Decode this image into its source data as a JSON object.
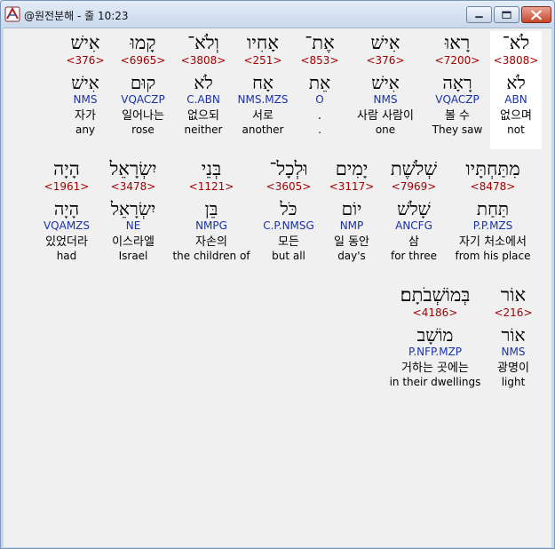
{
  "window": {
    "title": "@원전분해 - 줄 10:23",
    "minimize_label": "minimize",
    "maximize_label": "maximize",
    "close_label": "close"
  },
  "rows": [
    {
      "words": [
        {
          "heb": "לֹא־",
          "num": "<3808>",
          "lemma": "לֹא",
          "parse": "ABN",
          "kor": "없으며",
          "eng": "not",
          "selected": true
        },
        {
          "heb": "רָאוּ",
          "num": "<7200>",
          "lemma": "רָאָה",
          "parse": "VQACZP",
          "kor": "볼 수",
          "eng": "They saw"
        },
        {
          "heb": "אִישׁ",
          "num": "<376>",
          "lemma": "אִישׁ",
          "parse": "NMS",
          "kor": "사람 사람이",
          "eng": "one"
        },
        {
          "heb": "אֶת־",
          "num": "<853>",
          "lemma": "אֵת",
          "parse": "O",
          "kor": ".",
          "eng": "."
        },
        {
          "heb": "אָחִיו",
          "num": "<251>",
          "lemma": "אָח",
          "parse": "NMS.MZS",
          "kor": "서로",
          "eng": "another"
        },
        {
          "heb": "וְלֹא־",
          "num": "<3808>",
          "lemma": "לֹא",
          "parse": "C.ABN",
          "kor": "없으되",
          "eng": "neither"
        },
        {
          "heb": "קָמוּ",
          "num": "<6965>",
          "lemma": "קוּם",
          "parse": "VQACZP",
          "kor": "일어나는",
          "eng": "rose"
        },
        {
          "heb": "אִישׁ",
          "num": "<376>",
          "lemma": "אִישׁ",
          "parse": "NMS",
          "kor": "자가",
          "eng": "any"
        }
      ]
    },
    {
      "words": [
        {
          "heb": "מִתַּחְתָּיו",
          "num": "<8478>",
          "lemma": "תַּחַת",
          "parse": "P.P.MZS",
          "kor": "자기 처소에서",
          "eng": "from his place"
        },
        {
          "heb": "שְׁלֹשֶׁת",
          "num": "<7969>",
          "lemma": "שָׁלֹשׁ",
          "parse": "ANCFG",
          "kor": "삼",
          "eng": "for three"
        },
        {
          "heb": "יָמִים",
          "num": "<3117>",
          "lemma": "יוֹם",
          "parse": "NMP",
          "kor": "일 동안",
          "eng": "day's"
        },
        {
          "heb": "וּלְכָל־",
          "num": "<3605>",
          "lemma": "כֹּל",
          "parse": "C.P.NMSG",
          "kor": "모든",
          "eng": "but all"
        },
        {
          "heb": "בְּנֵי",
          "num": "<1121>",
          "lemma": "בֵּן",
          "parse": "NMPG",
          "kor": "자손의",
          "eng": "the children of"
        },
        {
          "heb": "יִשְׂרָאֵל",
          "num": "<3478>",
          "lemma": "יִשְׂרָאֵל",
          "parse": "NE",
          "kor": "이스라엘",
          "eng": "Israel"
        },
        {
          "heb": "הָיָה",
          "num": "<1961>",
          "lemma": "הָיָה",
          "parse": "VQAMZS",
          "kor": "있었더라",
          "eng": "had"
        }
      ]
    },
    {
      "words": [
        {
          "heb": "אוֹר",
          "num": "<216>",
          "lemma": "אוֹר",
          "parse": "NMS",
          "kor": "광명이",
          "eng": "light"
        },
        {
          "heb": "בְּמוֹשְׁבֹתָם׃",
          "num": "<4186>",
          "lemma": "מוֹשָׁב",
          "parse": "P.NFP.MZP",
          "kor": "거하는 곳에는",
          "eng": "in their dwellings"
        }
      ]
    }
  ]
}
